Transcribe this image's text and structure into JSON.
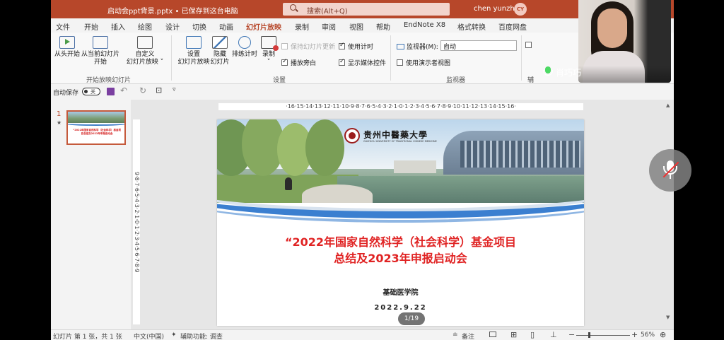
{
  "titlebar": {
    "file": "启动会ppt背景.pptx • 已保存到这台电脑",
    "search_placeholder": "搜索(Alt+Q)",
    "user": "chen yunzhi",
    "avatar": "CY"
  },
  "tabs": [
    "文件",
    "开始",
    "插入",
    "绘图",
    "设计",
    "切换",
    "动画",
    "幻灯片放映",
    "录制",
    "审阅",
    "视图",
    "帮助",
    "EndNote X8",
    "格式转换",
    "百度网盘"
  ],
  "active_tab": "幻灯片放映",
  "ribbon": {
    "from_start": "从头开始",
    "from_current_1": "从当前幻灯片",
    "from_current_2": "开始",
    "custom_1": "自定义",
    "custom_2": "幻灯片放映 ˅",
    "group_start": "开始放映幻灯片",
    "setup_1": "设置",
    "setup_2": "幻灯片放映",
    "hide_1": "隐藏",
    "hide_2": "幻灯片",
    "rehearse": "排练计时",
    "record_1": "录制",
    "record_2": "˅",
    "keep_updated": "保持幻灯片更新",
    "play_narration": "播放旁白",
    "use_timings": "使用计时",
    "show_media": "显示媒体控件",
    "group_setup": "设置",
    "monitor_label": "监视器(M):",
    "monitor_value": "自动",
    "presenter_view": "使用演示者视图",
    "group_monitor": "监视器",
    "partial": "辅"
  },
  "qat": {
    "autosave": "自动保存",
    "toggle": "关"
  },
  "thumbnail": {
    "number": "1",
    "star": "★",
    "text": "“2022年国家自然科学（社会科学）基金项目总结及2023年申报启动会"
  },
  "ruler": {
    "horizontal": "·16·15·14·13·12·11·10·9·8·7·6·5·4·3·2·1·0·1·2·3·4·5·6·7·8·9·10·11·12·13·14·15·16·",
    "vertical": "9·8·7·6·5·4·3·2·1·0·1·2·3·4·5·6·7·8·9"
  },
  "slide": {
    "university_cn": "贵州中醫藥大學",
    "university_en": "GUIZHOU UNIVERSITY OF TRADITIONAL CHINESE MEDICINE",
    "title_line1": "“2022年国家自然科学（社会科学）基金项目",
    "title_line2": "总结及2023年申报启动会",
    "organizer": "基础医学院",
    "date": "2022.9.22",
    "page_indicator": "1/19"
  },
  "statusbar": {
    "slide_info": "幻灯片 第 1 张，共 1 张",
    "language": "中文(中国)",
    "accessibility": "辅助功能: 调查",
    "notes": "备注",
    "zoom": "56%"
  },
  "meeting": {
    "participant_name": "肖巧巧"
  },
  "colors": {
    "accent": "#b7472a",
    "title_red": "#e02323",
    "swoosh_blue": "#3b7fd0"
  }
}
